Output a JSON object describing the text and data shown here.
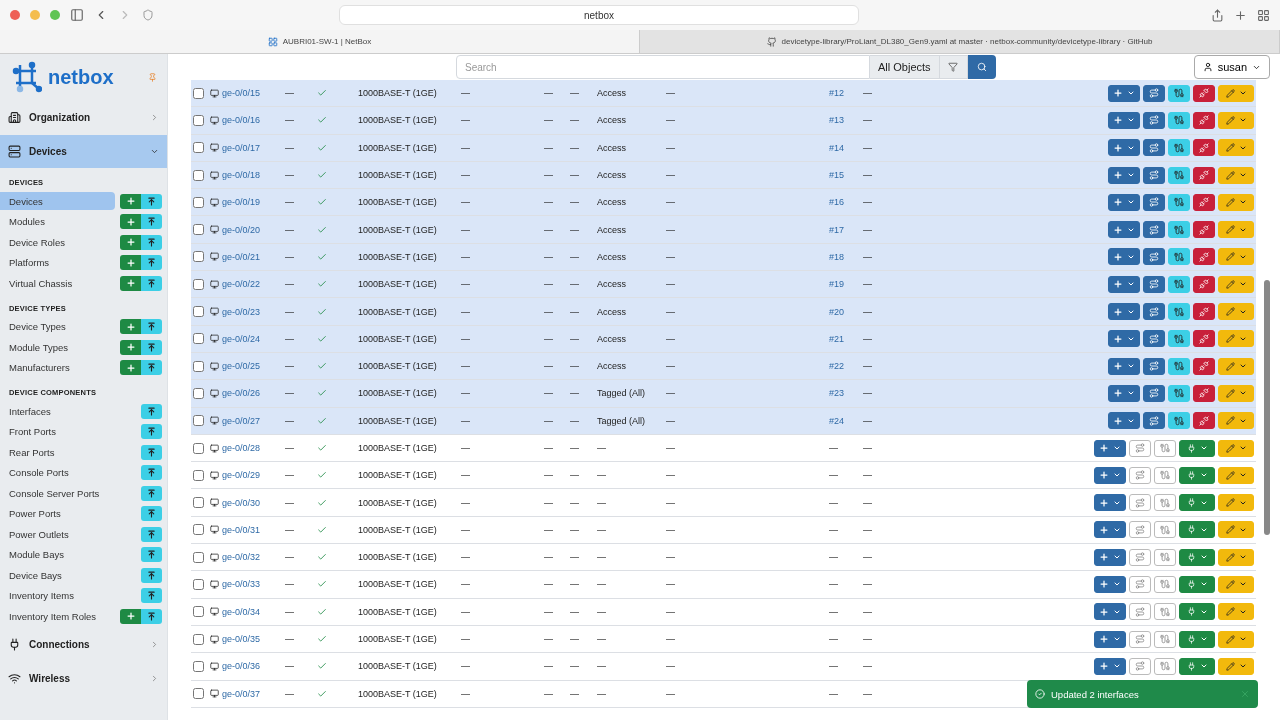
{
  "browser": {
    "address": "netbox",
    "tabs": [
      {
        "title": "AUBRI01-SW-1 | NetBox",
        "selected": true,
        "kind": "netbox"
      },
      {
        "title": "devicetype-library/ProLiant_DL380_Gen9.yaml at master · netbox-community/devicetype-library · GitHub",
        "selected": false,
        "kind": "github"
      }
    ]
  },
  "logo": "netbox",
  "header": {
    "search": {
      "placeholder": "Search"
    },
    "scope": "All Objects",
    "user": "susan"
  },
  "sidebar": {
    "groups": [
      {
        "label": "Organization",
        "kind": "organization",
        "expanded": false
      },
      {
        "label": "Devices",
        "kind": "devices",
        "expanded": true,
        "sections": [
          {
            "title": "DEVICES",
            "items": [
              {
                "label": "Devices",
                "selected": true,
                "add": true
              },
              {
                "label": "Modules",
                "selected": false,
                "add": true
              },
              {
                "label": "Device Roles",
                "selected": false,
                "add": true
              },
              {
                "label": "Platforms",
                "selected": false,
                "add": true
              },
              {
                "label": "Virtual Chassis",
                "selected": false,
                "add": true
              }
            ]
          },
          {
            "title": "DEVICE TYPES",
            "items": [
              {
                "label": "Device Types",
                "selected": false,
                "add": true
              },
              {
                "label": "Module Types",
                "selected": false,
                "add": true
              },
              {
                "label": "Manufacturers",
                "selected": false,
                "add": true
              }
            ]
          },
          {
            "title": "DEVICE COMPONENTS",
            "items": [
              {
                "label": "Interfaces",
                "selected": false,
                "add": false
              },
              {
                "label": "Front Ports",
                "selected": false,
                "add": false
              },
              {
                "label": "Rear Ports",
                "selected": false,
                "add": false
              },
              {
                "label": "Console Ports",
                "selected": false,
                "add": false
              },
              {
                "label": "Console Server Ports",
                "selected": false,
                "add": false
              },
              {
                "label": "Power Ports",
                "selected": false,
                "add": false
              },
              {
                "label": "Power Outlets",
                "selected": false,
                "add": false
              },
              {
                "label": "Module Bays",
                "selected": false,
                "add": false
              },
              {
                "label": "Device Bays",
                "selected": false,
                "add": false
              },
              {
                "label": "Inventory Items",
                "selected": false,
                "add": false
              },
              {
                "label": "Inventory Item Roles",
                "selected": false,
                "add": true
              }
            ]
          }
        ]
      },
      {
        "label": "Connections",
        "kind": "connections",
        "expanded": false
      },
      {
        "label": "Wireless",
        "kind": "wireless",
        "expanded": false
      }
    ]
  },
  "table": {
    "rows": [
      {
        "checked": false,
        "name": "ge-0/0/15",
        "column_2": "—",
        "enabled": true,
        "type": "1000BASE-T (1GE)",
        "column_5": "—",
        "column_6": "—",
        "column_7": "—",
        "mode": "Access",
        "column_9": "—",
        "cable": "#12",
        "column_11": "—",
        "selected": true,
        "connected": true
      },
      {
        "checked": false,
        "name": "ge-0/0/16",
        "column_2": "—",
        "enabled": true,
        "type": "1000BASE-T (1GE)",
        "column_5": "—",
        "column_6": "—",
        "column_7": "—",
        "mode": "Access",
        "column_9": "—",
        "cable": "#13",
        "column_11": "—",
        "selected": true,
        "connected": true
      },
      {
        "checked": false,
        "name": "ge-0/0/17",
        "column_2": "—",
        "enabled": true,
        "type": "1000BASE-T (1GE)",
        "column_5": "—",
        "column_6": "—",
        "column_7": "—",
        "mode": "Access",
        "column_9": "—",
        "cable": "#14",
        "column_11": "—",
        "selected": true,
        "connected": true
      },
      {
        "checked": false,
        "name": "ge-0/0/18",
        "column_2": "—",
        "enabled": true,
        "type": "1000BASE-T (1GE)",
        "column_5": "—",
        "column_6": "—",
        "column_7": "—",
        "mode": "Access",
        "column_9": "—",
        "cable": "#15",
        "column_11": "—",
        "selected": true,
        "connected": true
      },
      {
        "checked": false,
        "name": "ge-0/0/19",
        "column_2": "—",
        "enabled": true,
        "type": "1000BASE-T (1GE)",
        "column_5": "—",
        "column_6": "—",
        "column_7": "—",
        "mode": "Access",
        "column_9": "—",
        "cable": "#16",
        "column_11": "—",
        "selected": true,
        "connected": true
      },
      {
        "checked": false,
        "name": "ge-0/0/20",
        "column_2": "—",
        "enabled": true,
        "type": "1000BASE-T (1GE)",
        "column_5": "—",
        "column_6": "—",
        "column_7": "—",
        "mode": "Access",
        "column_9": "—",
        "cable": "#17",
        "column_11": "—",
        "selected": true,
        "connected": true
      },
      {
        "checked": false,
        "name": "ge-0/0/21",
        "column_2": "—",
        "enabled": true,
        "type": "1000BASE-T (1GE)",
        "column_5": "—",
        "column_6": "—",
        "column_7": "—",
        "mode": "Access",
        "column_9": "—",
        "cable": "#18",
        "column_11": "—",
        "selected": true,
        "connected": true
      },
      {
        "checked": false,
        "name": "ge-0/0/22",
        "column_2": "—",
        "enabled": true,
        "type": "1000BASE-T (1GE)",
        "column_5": "—",
        "column_6": "—",
        "column_7": "—",
        "mode": "Access",
        "column_9": "—",
        "cable": "#19",
        "column_11": "—",
        "selected": true,
        "connected": true
      },
      {
        "checked": false,
        "name": "ge-0/0/23",
        "column_2": "—",
        "enabled": true,
        "type": "1000BASE-T (1GE)",
        "column_5": "—",
        "column_6": "—",
        "column_7": "—",
        "mode": "Access",
        "column_9": "—",
        "cable": "#20",
        "column_11": "—",
        "selected": true,
        "connected": true
      },
      {
        "checked": false,
        "name": "ge-0/0/24",
        "column_2": "—",
        "enabled": true,
        "type": "1000BASE-T (1GE)",
        "column_5": "—",
        "column_6": "—",
        "column_7": "—",
        "mode": "Access",
        "column_9": "—",
        "cable": "#21",
        "column_11": "—",
        "selected": true,
        "connected": true
      },
      {
        "checked": false,
        "name": "ge-0/0/25",
        "column_2": "—",
        "enabled": true,
        "type": "1000BASE-T (1GE)",
        "column_5": "—",
        "column_6": "—",
        "column_7": "—",
        "mode": "Access",
        "column_9": "—",
        "cable": "#22",
        "column_11": "—",
        "selected": true,
        "connected": true
      },
      {
        "checked": false,
        "name": "ge-0/0/26",
        "column_2": "—",
        "enabled": true,
        "type": "1000BASE-T (1GE)",
        "column_5": "—",
        "column_6": "—",
        "column_7": "—",
        "mode": "Tagged (All)",
        "column_9": "—",
        "cable": "#23",
        "column_11": "—",
        "selected": true,
        "connected": true
      },
      {
        "checked": false,
        "name": "ge-0/0/27",
        "column_2": "—",
        "enabled": true,
        "type": "1000BASE-T (1GE)",
        "column_5": "—",
        "column_6": "—",
        "column_7": "—",
        "mode": "Tagged (All)",
        "column_9": "—",
        "cable": "#24",
        "column_11": "—",
        "selected": true,
        "connected": true
      },
      {
        "checked": false,
        "name": "ge-0/0/28",
        "column_2": "—",
        "enabled": true,
        "type": "1000BASE-T (1GE)",
        "column_5": "—",
        "column_6": "—",
        "column_7": "—",
        "mode": "—",
        "column_9": "—",
        "cable": "—",
        "column_11": "—",
        "selected": false,
        "connected": false
      },
      {
        "checked": false,
        "name": "ge-0/0/29",
        "column_2": "—",
        "enabled": true,
        "type": "1000BASE-T (1GE)",
        "column_5": "—",
        "column_6": "—",
        "column_7": "—",
        "mode": "—",
        "column_9": "—",
        "cable": "—",
        "column_11": "—",
        "selected": false,
        "connected": false
      },
      {
        "checked": false,
        "name": "ge-0/0/30",
        "column_2": "—",
        "enabled": true,
        "type": "1000BASE-T (1GE)",
        "column_5": "—",
        "column_6": "—",
        "column_7": "—",
        "mode": "—",
        "column_9": "—",
        "cable": "—",
        "column_11": "—",
        "selected": false,
        "connected": false
      },
      {
        "checked": false,
        "name": "ge-0/0/31",
        "column_2": "—",
        "enabled": true,
        "type": "1000BASE-T (1GE)",
        "column_5": "—",
        "column_6": "—",
        "column_7": "—",
        "mode": "—",
        "column_9": "—",
        "cable": "—",
        "column_11": "—",
        "selected": false,
        "connected": false
      },
      {
        "checked": false,
        "name": "ge-0/0/32",
        "column_2": "—",
        "enabled": true,
        "type": "1000BASE-T (1GE)",
        "column_5": "—",
        "column_6": "—",
        "column_7": "—",
        "mode": "—",
        "column_9": "—",
        "cable": "—",
        "column_11": "—",
        "selected": false,
        "connected": false
      },
      {
        "checked": false,
        "name": "ge-0/0/33",
        "column_2": "—",
        "enabled": true,
        "type": "1000BASE-T (1GE)",
        "column_5": "—",
        "column_6": "—",
        "column_7": "—",
        "mode": "—",
        "column_9": "—",
        "cable": "—",
        "column_11": "—",
        "selected": false,
        "connected": false
      },
      {
        "checked": false,
        "name": "ge-0/0/34",
        "column_2": "—",
        "enabled": true,
        "type": "1000BASE-T (1GE)",
        "column_5": "—",
        "column_6": "—",
        "column_7": "—",
        "mode": "—",
        "column_9": "—",
        "cable": "—",
        "column_11": "—",
        "selected": false,
        "connected": false
      },
      {
        "checked": false,
        "name": "ge-0/0/35",
        "column_2": "—",
        "enabled": true,
        "type": "1000BASE-T (1GE)",
        "column_5": "—",
        "column_6": "—",
        "column_7": "—",
        "mode": "—",
        "column_9": "—",
        "cable": "—",
        "column_11": "—",
        "selected": false,
        "connected": false
      },
      {
        "checked": false,
        "name": "ge-0/0/36",
        "column_2": "—",
        "enabled": true,
        "type": "1000BASE-T (1GE)",
        "column_5": "—",
        "column_6": "—",
        "column_7": "—",
        "mode": "—",
        "column_9": "—",
        "cable": "—",
        "column_11": "—",
        "selected": false,
        "connected": false
      },
      {
        "checked": false,
        "name": "ge-0/0/37",
        "column_2": "—",
        "enabled": true,
        "type": "1000BASE-T (1GE)",
        "column_5": "—",
        "column_6": "—",
        "column_7": "—",
        "mode": "—",
        "column_9": "—",
        "cable": "—",
        "column_11": "—",
        "selected": false,
        "connected": false,
        "actions_hidden": true
      }
    ]
  },
  "toast": {
    "message": "Updated 2 interfaces"
  }
}
